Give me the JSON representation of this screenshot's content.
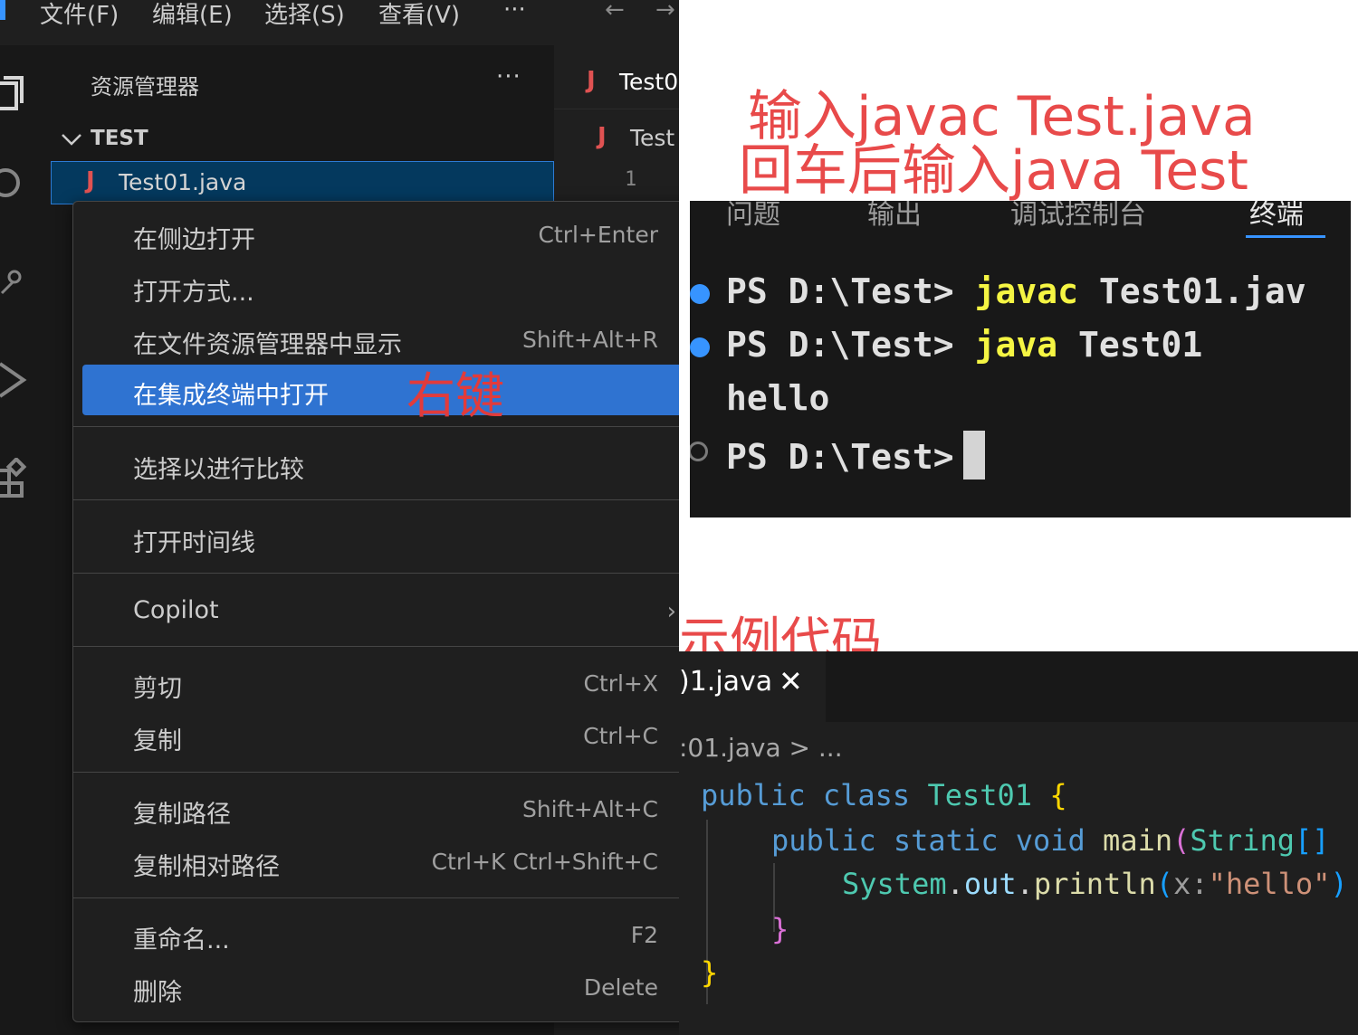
{
  "menubar": {
    "items": [
      "文件(F)",
      "编辑(E)",
      "选择(S)",
      "查看(V)",
      "···"
    ],
    "nav_back": "←",
    "nav_forward": "→"
  },
  "explorer": {
    "title": "资源管理器",
    "more": "···",
    "folder": "TEST",
    "file": "Test01.java",
    "file_icon": "J"
  },
  "editor_strip": {
    "tab_label": "Test0",
    "breadcrumb": "Test",
    "line_number": "1"
  },
  "context_menu": {
    "items": [
      {
        "label": "在侧边打开",
        "key": "Ctrl+Enter"
      },
      {
        "label": "打开方式...",
        "key": ""
      },
      {
        "label": "在文件资源管理器中显示",
        "key": "Shift+Alt+R"
      },
      {
        "label": "在集成终端中打开",
        "key": ""
      },
      {
        "label": "选择以进行比较",
        "key": ""
      },
      {
        "label": "打开时间线",
        "key": ""
      },
      {
        "label": "Copilot",
        "key": ""
      },
      {
        "label": "剪切",
        "key": "Ctrl+X"
      },
      {
        "label": "复制",
        "key": "Ctrl+C"
      },
      {
        "label": "复制路径",
        "key": "Shift+Alt+C"
      },
      {
        "label": "复制相对路径",
        "key": "Ctrl+K Ctrl+Shift+C"
      },
      {
        "label": "重命名...",
        "key": "F2"
      },
      {
        "label": "删除",
        "key": "Delete"
      }
    ],
    "selected_index": 3,
    "submenu_chevron": "›",
    "annotation": "右键"
  },
  "notes": {
    "line1": "输入javac Test.java",
    "line2": "回车后输入java Test",
    "example": "示例代码"
  },
  "terminal": {
    "tabs": [
      "问题",
      "输出",
      "调试控制台",
      "终端"
    ],
    "active_tab": "终端",
    "lines": [
      {
        "prompt": "PS D:\\Test>",
        "cmd": "javac",
        "arg": "Test01.jav"
      },
      {
        "prompt": "PS D:\\Test>",
        "cmd": "java",
        "arg": "Test01"
      },
      {
        "output": "hello"
      },
      {
        "prompt": "PS D:\\Test>"
      }
    ]
  },
  "code_editor": {
    "tab_label": ")1.java",
    "tab_close": "✕",
    "breadcrumb": ":01.java > ...",
    "lines": [
      "public class Test01 {",
      "public static void main(String[]",
      "System.out.println(x:\"hello\")",
      "}",
      "}"
    ],
    "tokens": {
      "public": "public",
      "class": "class",
      "class_name": "Test01",
      "static": "static",
      "void": "void",
      "main": "main",
      "string_type": "String",
      "brackets": "[]",
      "system": "System",
      "out": "out",
      "println": "println",
      "param_hint": "x:",
      "string_literal": "\"hello\""
    }
  },
  "colors": {
    "accent_blue": "#2f73d1",
    "annotation_red": "#e84a4a",
    "terminal_cmd_yellow": "#f5f543"
  }
}
